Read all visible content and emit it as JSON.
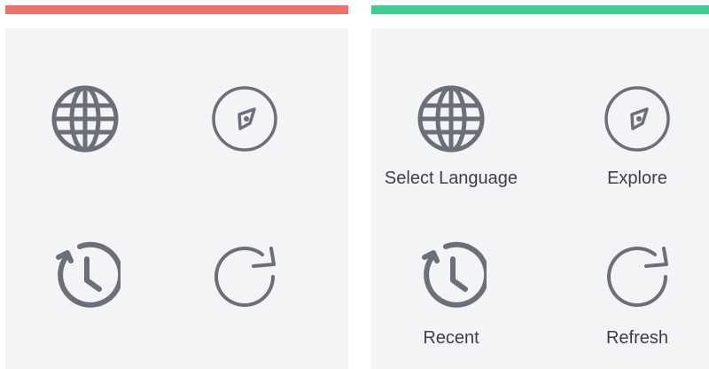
{
  "colors": {
    "left_accent": "#f0706a",
    "right_accent": "#3cce94",
    "icon_stroke": "#6b6f7a",
    "card_bg": "#f3f4f5",
    "label_text": "#3a3f48"
  },
  "left_panel": {
    "variant": "icons-only",
    "tiles": [
      {
        "icon": "globe-icon"
      },
      {
        "icon": "compass-icon"
      },
      {
        "icon": "history-icon"
      },
      {
        "icon": "refresh-icon"
      }
    ]
  },
  "right_panel": {
    "variant": "icons-with-labels",
    "tiles": [
      {
        "icon": "globe-icon",
        "label": "Select Language"
      },
      {
        "icon": "compass-icon",
        "label": "Explore"
      },
      {
        "icon": "history-icon",
        "label": "Recent"
      },
      {
        "icon": "refresh-icon",
        "label": "Refresh"
      }
    ]
  }
}
